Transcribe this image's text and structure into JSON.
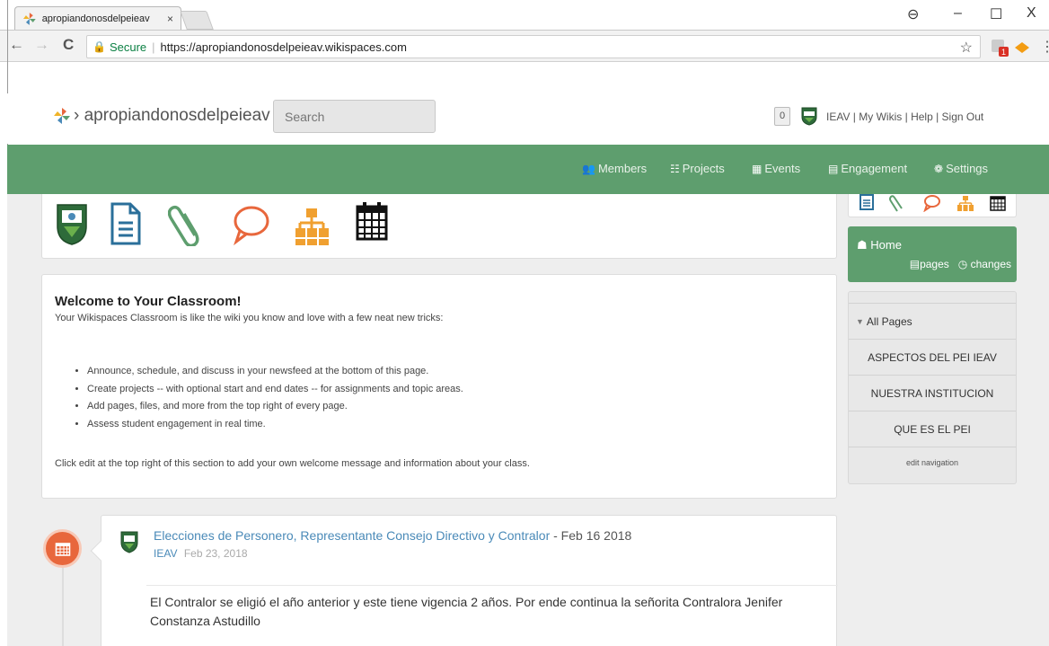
{
  "browser": {
    "tab_title": "apropiandonosdelpeieav",
    "tab_close": "×",
    "secure_label": "Secure",
    "url": "https://apropiandonosdelpeieav.wikispaces.com",
    "window_controls": {
      "account": "⊖",
      "minimize": "–",
      "maximize": "☐",
      "close": "X"
    },
    "nav": {
      "back": "←",
      "forward": "→",
      "reload": "C"
    },
    "star": "☆",
    "ext_badge": "1"
  },
  "wiki": {
    "logo_text": "› apropiandonosdelpeieav",
    "search_placeholder": "Search",
    "notif_count": "0",
    "user_links": [
      "IEAV",
      "My Wikis",
      "Help",
      "Sign Out"
    ],
    "nav": [
      {
        "icon": "members-icon",
        "label": "Members"
      },
      {
        "icon": "projects-icon",
        "label": "Projects"
      },
      {
        "icon": "events-icon",
        "label": "Events"
      },
      {
        "icon": "engagement-icon",
        "label": "Engagement"
      },
      {
        "icon": "settings-icon",
        "label": "Settings"
      }
    ]
  },
  "welcome": {
    "title": "Welcome to Your Classroom!",
    "intro": "Your Wikispaces Classroom is like the wiki you know and love with a few neat new tricks:",
    "bullets": [
      "Announce, schedule, and discuss in your newsfeed at the bottom of this page.",
      "Create projects -- with optional start and end dates -- for assignments and topic areas.",
      "Add pages, files, and more from the top right of every page.",
      "Assess student engagement in real time."
    ],
    "outro": "Click edit at the top right of this section to add your own welcome message and information about your class."
  },
  "feed": {
    "title_link": "Elecciones de Personero, Representante Consejo Directivo y Contralor",
    "title_suffix": " - Feb 16 2018",
    "author": "IEAV",
    "date": "Feb 23, 2018",
    "body": "El Contralor se eligió el año anterior y este tiene vigencia 2 años. Por ende continua la señorita Contralora Jenifer Constanza Astudillo"
  },
  "sidebar": {
    "home_label": "Home",
    "pages_label": "pages",
    "changes_label": "changes",
    "all_pages_label": "All Pages",
    "pages": [
      "ASPECTOS DEL PEI IEAV",
      "NUESTRA INSTITUCION",
      "QUE ES EL PEI"
    ],
    "edit_nav_label": "edit navigation"
  },
  "colors": {
    "green": "#5e9e6e",
    "orange": "#e8673c",
    "link_blue": "#4a8ab8",
    "doc_blue": "#2a6f9a",
    "clip_green": "#5e9e6e"
  }
}
